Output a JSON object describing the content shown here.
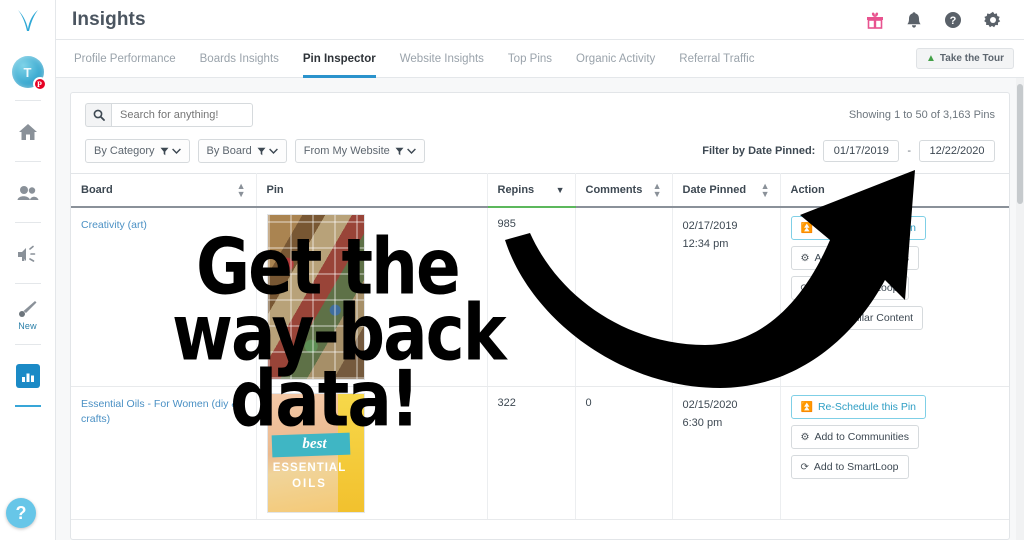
{
  "app": {
    "title": "Insights",
    "logo_icon": "tailwind-bird-logo"
  },
  "sidebar": {
    "avatar_initial": "T",
    "avatar_badge": "P",
    "items": [
      {
        "name": "home",
        "icon": "home-icon",
        "label": ""
      },
      {
        "name": "communities",
        "icon": "people-icon",
        "label": ""
      },
      {
        "name": "promote",
        "icon": "megaphone-icon",
        "label": ""
      },
      {
        "name": "create",
        "icon": "brush-icon",
        "label": "New"
      },
      {
        "name": "insights",
        "icon": "bar-chart-icon",
        "label": ""
      }
    ],
    "help_label": "?"
  },
  "header": {
    "icons": [
      {
        "name": "gift-icon",
        "glyph": "gift",
        "color": "#e8538f"
      },
      {
        "name": "bell-icon",
        "glyph": "bell",
        "color": "#5a6169"
      },
      {
        "name": "help-icon",
        "glyph": "question",
        "color": "#5a6169"
      },
      {
        "name": "gear-icon",
        "glyph": "gear",
        "color": "#5a6169"
      }
    ]
  },
  "tabs": {
    "items": [
      {
        "label": "Profile Performance",
        "active": false
      },
      {
        "label": "Boards Insights",
        "active": false
      },
      {
        "label": "Pin Inspector",
        "active": true
      },
      {
        "label": "Website Insights",
        "active": false
      },
      {
        "label": "Top Pins",
        "active": false
      },
      {
        "label": "Organic Activity",
        "active": false
      },
      {
        "label": "Referral Traffic",
        "active": false
      }
    ],
    "tour_button": "Take the Tour",
    "tour_icon": "sprout-icon",
    "active_underline_color": "#2b93cc"
  },
  "search": {
    "placeholder": "Search for anything!",
    "value": "",
    "icon": "search-icon",
    "showing": "Showing 1 to 50 of 3,163 Pins"
  },
  "filters": {
    "dropdowns": [
      {
        "label": "By Category",
        "icon": "funnel-icon"
      },
      {
        "label": "By Board",
        "icon": "funnel-icon"
      },
      {
        "label": "From My Website",
        "icon": "funnel-icon"
      }
    ],
    "date_label": "Filter by Date Pinned:",
    "date_from": "01/17/2019",
    "date_separator": "-",
    "date_to": "12/22/2020"
  },
  "table": {
    "columns": [
      {
        "label": "Board",
        "sortable": true,
        "sorted": false
      },
      {
        "label": "Pin",
        "sortable": false,
        "sorted": false
      },
      {
        "label": "Repins",
        "sortable": true,
        "sorted": true,
        "direction": "desc"
      },
      {
        "label": "Comments",
        "sortable": true,
        "sorted": false
      },
      {
        "label": "Date Pinned",
        "sortable": true,
        "sorted": false
      },
      {
        "label": "Action",
        "sortable": false,
        "sorted": false
      }
    ],
    "sorted_underline_color": "#5cb85c",
    "rows": [
      {
        "board": "Creativity (art)",
        "pin_alt": "vintage-art-collage-thumbnail",
        "repins": "985",
        "comments": "",
        "date": "02/17/2019",
        "time": "12:34 pm",
        "actions": [
          {
            "label": "Re-Schedule this Pin",
            "icon": "schedule-icon",
            "primary": true
          },
          {
            "label": "Add to Communities",
            "icon": "communities-icon",
            "primary": false
          },
          {
            "label": "Add to SmartLoop",
            "icon": "loop-icon",
            "primary": false
          },
          {
            "label": "Find Similar Content",
            "icon": "lightbulb-icon",
            "primary": false
          }
        ]
      },
      {
        "board": "Essential Oils - For Women (diy & crafts)",
        "pin_alt": "best-essential-oils-thumbnail",
        "pin_text_script": "best",
        "pin_text_line1": "ESSENTIAL",
        "pin_text_line2": "OILS",
        "repins": "322",
        "comments": "0",
        "date": "02/15/2020",
        "time": "6:30 pm",
        "actions": [
          {
            "label": "Re-Schedule this Pin",
            "icon": "schedule-icon",
            "primary": true
          },
          {
            "label": "Add to Communities",
            "icon": "communities-icon",
            "primary": false
          },
          {
            "label": "Add to SmartLoop",
            "icon": "loop-icon",
            "primary": false
          }
        ]
      }
    ]
  },
  "overlay": {
    "line1": "Get the",
    "line2": "way-back",
    "line3": "data!",
    "arrow_icon": "curved-arrow-annotation",
    "color": "#000000"
  }
}
